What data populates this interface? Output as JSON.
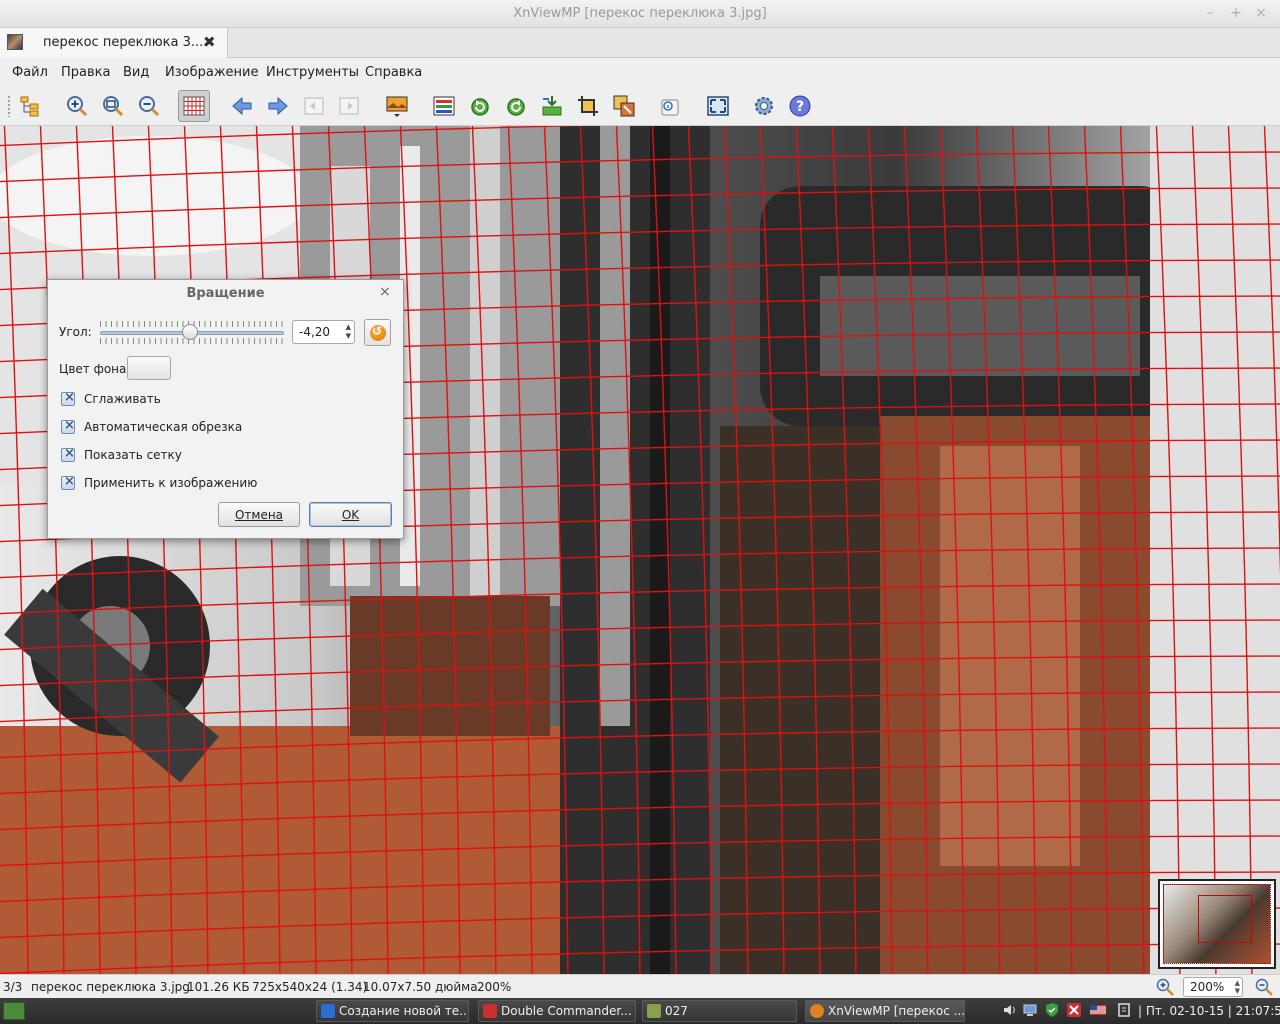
{
  "window": {
    "title": "XnViewMP [перекос переклюка 3.jpg]",
    "controls": [
      "–",
      "+",
      "×"
    ]
  },
  "tab": {
    "label": "перекос переклюка 3....",
    "close": "✖"
  },
  "menu": [
    "Файл",
    "Правка",
    "Вид",
    "Изображение",
    "Инструменты",
    "Справка"
  ],
  "toolbar": {
    "icons": [
      "browser-icon",
      "zoom-in-icon",
      "zoom-fit-icon",
      "zoom-out-icon",
      "grid-icon",
      "previous-icon",
      "next-icon",
      "first-icon",
      "last-icon",
      "wallpaper-icon",
      "adjust-icon",
      "rotate-left-icon",
      "rotate-right-icon",
      "import-icon",
      "crop-icon",
      "resize-icon",
      "info-icon",
      "fullscreen-icon",
      "settings-icon",
      "help-icon"
    ],
    "active": "grid-icon"
  },
  "dialog": {
    "title": "Вращение",
    "close": "×",
    "angle_label": "Угол:",
    "angle_value": "-4,20",
    "bg_color_label": "Цвет фона",
    "checkboxes": [
      {
        "label": "Сглаживать",
        "checked": true
      },
      {
        "label": "Автоматическая обрезка",
        "checked": true
      },
      {
        "label": "Показать сетку",
        "checked": true
      },
      {
        "label": "Применить к изображению",
        "checked": true
      }
    ],
    "cancel": "Отмена",
    "ok": "OK"
  },
  "status": {
    "index": "3/3",
    "filename": "перекос переклюка 3.jpg",
    "size": "101.26 КБ",
    "dimensions": "725x540x24 (1.34)",
    "print_size": "10.07x7.50 дюйма",
    "zoom": "200%",
    "zoom_field": "200%"
  },
  "taskbar": {
    "tasks": [
      {
        "label": "Создание новой те...",
        "color": "#2a6ecf"
      },
      {
        "label": "Double Commander...",
        "color": "#c83030"
      },
      {
        "label": "027",
        "color": "#8aa04a"
      },
      {
        "label": "XnViewMP [перекос ...",
        "color": "#e08020"
      }
    ],
    "clock": "| Пт. 02-10-15 | 21:07:53"
  },
  "colors": {
    "grid": "#e01010",
    "accent": "#e07000"
  }
}
